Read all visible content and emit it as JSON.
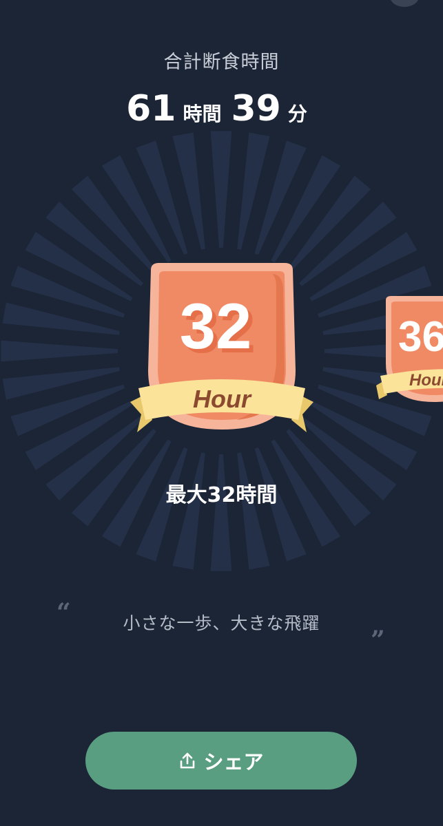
{
  "header": {
    "total_label": "合計断食時間",
    "hours_value": "61",
    "hours_unit": "時間",
    "minutes_value": "39",
    "minutes_unit": "分"
  },
  "badges": {
    "main": {
      "number": "32",
      "ribbon": "Hour"
    },
    "next": {
      "number": "36",
      "ribbon": "Hour"
    }
  },
  "achievement": "最大32時間",
  "quote": {
    "open_mark": "“",
    "text": "小さな一歩、大きな飛躍",
    "close_mark": "”"
  },
  "share_button": {
    "label": "シェア",
    "icon": "share-icon"
  },
  "colors": {
    "background": "#1c2536",
    "badge_orange": "#f08a64",
    "badge_rim": "#f6b49b",
    "ribbon_yellow": "#fbe39a",
    "ribbon_text": "#8b4a2f",
    "share_green": "#5a9e82"
  }
}
